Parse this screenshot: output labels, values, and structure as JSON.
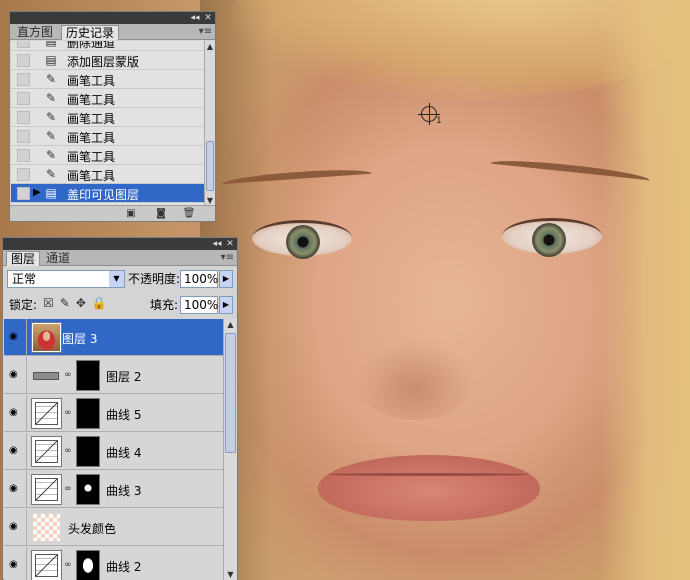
{
  "history_panel": {
    "tabs": [
      "直方图",
      "历史记录"
    ],
    "active_tab": 1,
    "items": [
      {
        "label": "删除通道",
        "icon": "document-icon"
      },
      {
        "label": "添加图层蒙版",
        "icon": "document-icon"
      },
      {
        "label": "画笔工具",
        "icon": "brush-icon"
      },
      {
        "label": "画笔工具",
        "icon": "brush-icon"
      },
      {
        "label": "画笔工具",
        "icon": "brush-icon"
      },
      {
        "label": "画笔工具",
        "icon": "brush-icon"
      },
      {
        "label": "画笔工具",
        "icon": "brush-icon"
      },
      {
        "label": "画笔工具",
        "icon": "brush-icon"
      },
      {
        "label": "盖印可见图层",
        "icon": "document-icon",
        "selected": true
      }
    ]
  },
  "layers_panel": {
    "tabs": [
      "图层",
      "通道"
    ],
    "active_tab": 0,
    "blend_mode": "正常",
    "opacity_label": "不透明度:",
    "opacity_value": "100%",
    "lock_label": "锁定:",
    "fill_label": "填充:",
    "fill_value": "100%",
    "layers": [
      {
        "name": "图层 3",
        "thumb": "photo",
        "selected": true
      },
      {
        "name": "图层 2",
        "thumb": "bar",
        "mask": true
      },
      {
        "name": "曲线 5",
        "thumb": "curves",
        "mask": true
      },
      {
        "name": "曲线 4",
        "thumb": "curves",
        "mask": true
      },
      {
        "name": "曲线 3",
        "thumb": "curves",
        "mask": true
      },
      {
        "name": "头发颜色",
        "thumb": "checker"
      },
      {
        "name": "曲线 2",
        "thumb": "curves",
        "mask": true
      }
    ]
  },
  "canvas": {
    "cursor_sub": "1"
  }
}
